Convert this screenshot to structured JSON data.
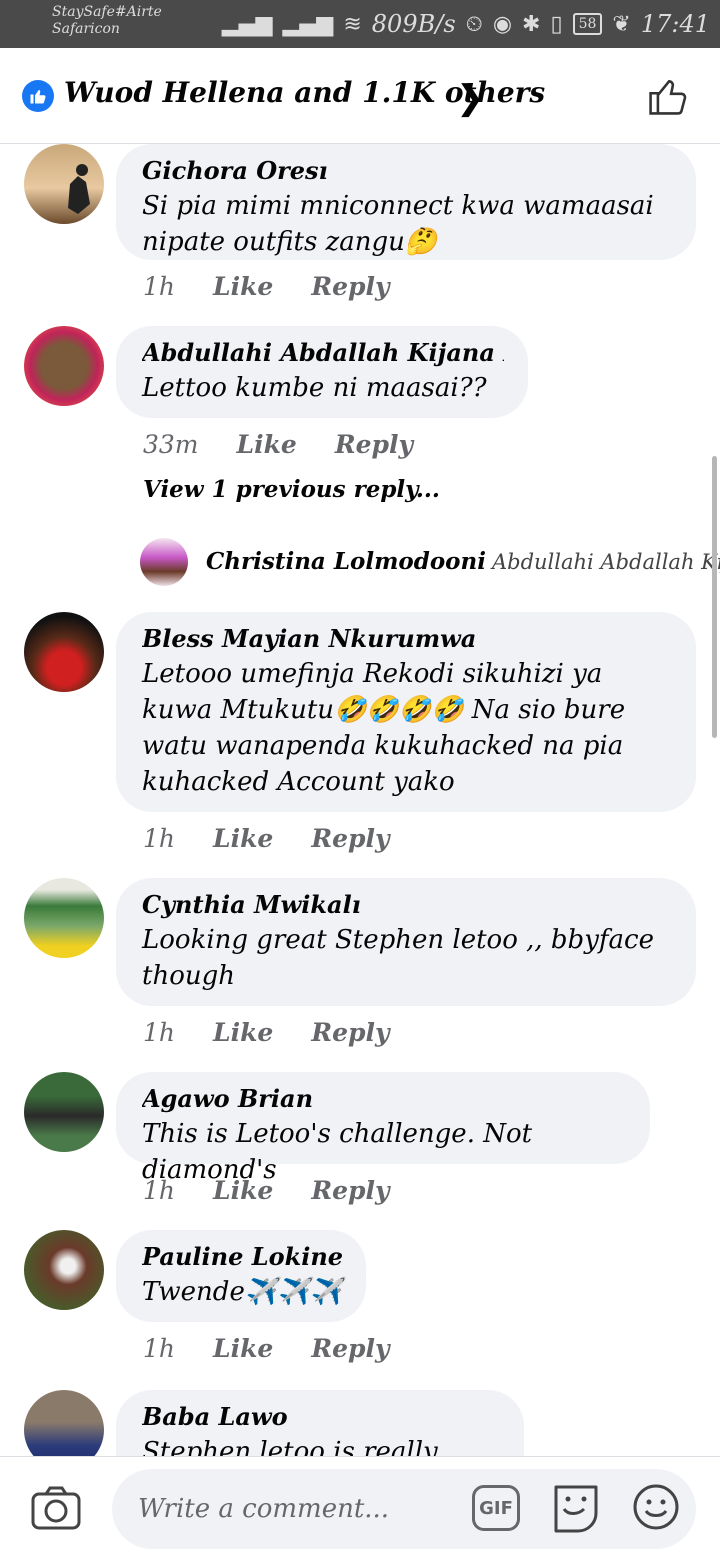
{
  "status_bar": {
    "carrier_line1": "StaySafe#Airte",
    "carrier_line2": "Safaricon",
    "speed": "809B/s",
    "battery": "58",
    "time": "17:41"
  },
  "reactions": {
    "summary": "Wuod Hellena and 1.1K others"
  },
  "comments": [
    {
      "author": "Gichora Oresı",
      "text": "Si pia mimi mniconnect kwa wamaasai nipate outfits zangu🤔",
      "time": "1h",
      "like": "Like",
      "reply": "Reply"
    },
    {
      "author": "Abdullahi Abdallah Kijana Mtamu",
      "text": "Lettoo kumbe ni maasai??",
      "time": "33m",
      "like": "Like",
      "reply": "Reply",
      "view_replies": "View 1 previous reply...",
      "reply_preview": {
        "author": "Christina Lolmodooni",
        "text": "Abdullahi Abdallah Kija..."
      }
    },
    {
      "author": "Bless Mayian Nkurumwa",
      "text": "Letooo umefinja Rekodi sikuhizi ya kuwa Mtukutu🤣🤣🤣🤣 Na sio bure watu wanapenda kukuhacked na pia kuhacked Account yako",
      "time": "1h",
      "like": "Like",
      "reply": "Reply"
    },
    {
      "author": "Cynthia Mwikalı",
      "text": "Looking great  Stephen letoo ,, bbyface though",
      "time": "1h",
      "like": "Like",
      "reply": "Reply"
    },
    {
      "author": "Agawo Brian",
      "text": "This is Letoo's challenge. Not diamond's",
      "time": "1h",
      "like": "Like",
      "reply": "Reply"
    },
    {
      "author": "Pauline Lokinei",
      "text": "Twende✈️✈️✈️",
      "time": "1h",
      "like": "Like",
      "reply": "Reply"
    },
    {
      "author": "Baba Lawo",
      "text": "Stephen letoo is really worrie"
    }
  ],
  "composer": {
    "placeholder": "Write a comment...",
    "gif_label": "GIF"
  },
  "colors": {
    "accent": "#1877f2",
    "bubble": "#f0f2f5",
    "secondary_text": "#65676b",
    "status_bar": "#4a4a4a"
  }
}
